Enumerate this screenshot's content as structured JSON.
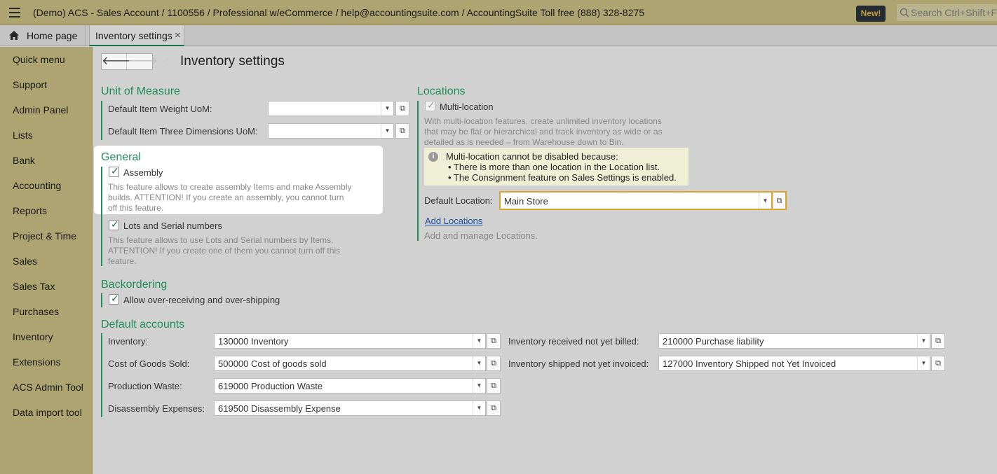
{
  "header": {
    "title": "(Demo) ACS - Sales Account / 1100556 / Professional w/eCommerce / help@accountingsuite.com / AccountingSuite Toll free (888) 328-8275",
    "new_badge": "New!",
    "search_placeholder": "Search Ctrl+Shift+F"
  },
  "tabs": {
    "home": "Home page",
    "active": "Inventory settings",
    "close": "×"
  },
  "sidebar": {
    "items": [
      "Quick menu",
      "Support",
      "Admin Panel",
      "Lists",
      "Bank",
      "Accounting",
      "Reports",
      "Project & Time",
      "Sales",
      "Sales Tax",
      "Purchases",
      "Inventory",
      "Extensions",
      "ACS Admin Tool",
      "Data import tool"
    ]
  },
  "page": {
    "title": "Inventory settings",
    "back": "🡐",
    "forward": "🡒",
    "star": "☆"
  },
  "uom": {
    "title": "Unit of Measure",
    "weight_label": "Default Item Weight UoM:",
    "weight_value": "",
    "dims_label": "Default Item Three Dimensions UoM:",
    "dims_value": ""
  },
  "general": {
    "title": "General",
    "assembly_label": "Assembly",
    "assembly_checked": true,
    "assembly_note_1": "This feature allows to create assembly Items and make Assembly",
    "assembly_note_2": "builds. ATTENTION! If you create an assembly, you cannot turn",
    "assembly_note_3": "off this feature.",
    "lots_label": "Lots and Serial numbers",
    "lots_checked": true,
    "lots_note_1": "This feature allows to use Lots and Serial numbers by Items.",
    "lots_note_2": "ATTENTION! If you create one of them you cannot turn off this",
    "lots_note_3": "feature."
  },
  "backordering": {
    "title": "Backordering",
    "allow_label": "Allow over-receiving and over-shipping",
    "allow_checked": true
  },
  "default_accounts": {
    "title": "Default accounts",
    "left": [
      {
        "label": "Inventory:",
        "value": "130000 Inventory"
      },
      {
        "label": "Cost of Goods Sold:",
        "value": "500000 Cost of goods sold"
      },
      {
        "label": "Production Waste:",
        "value": "619000 Production Waste"
      },
      {
        "label": "Disassembly Expenses:",
        "value": "619500 Disassembly Expense"
      }
    ],
    "right": [
      {
        "label": "Inventory received not yet billed:",
        "value": "210000 Purchase liability"
      },
      {
        "label": "Inventory shipped not yet invoiced:",
        "value": "127000 Inventory Shipped not Yet Invoiced"
      }
    ]
  },
  "locations": {
    "title": "Locations",
    "multi_label": "Multi-location",
    "multi_checked": true,
    "multi_note_1": "With multi-location features, create unlimited inventory locations",
    "multi_note_2": "that may be flat or hierarchical and track inventory as wide or as",
    "multi_note_3": "detailed as is needed – from Warehouse down to Bin.",
    "info_line_1": "Multi-location cannot be disabled because:",
    "info_line_2": "• There is more than one location in the Location list.",
    "info_line_3": "• The Consignment feature on Sales Settings is enabled.",
    "default_label": "Default Location:",
    "default_value": "Main Store",
    "add_link": "Add Locations",
    "add_note": "Add and manage Locations."
  },
  "icons": {
    "dropdown": "▼",
    "open": "⧉",
    "check": "✓",
    "info": "i"
  },
  "colors": {
    "accent": "#1f8f5a",
    "header": "#d3c98a",
    "highlight_border": "#d8a628"
  }
}
